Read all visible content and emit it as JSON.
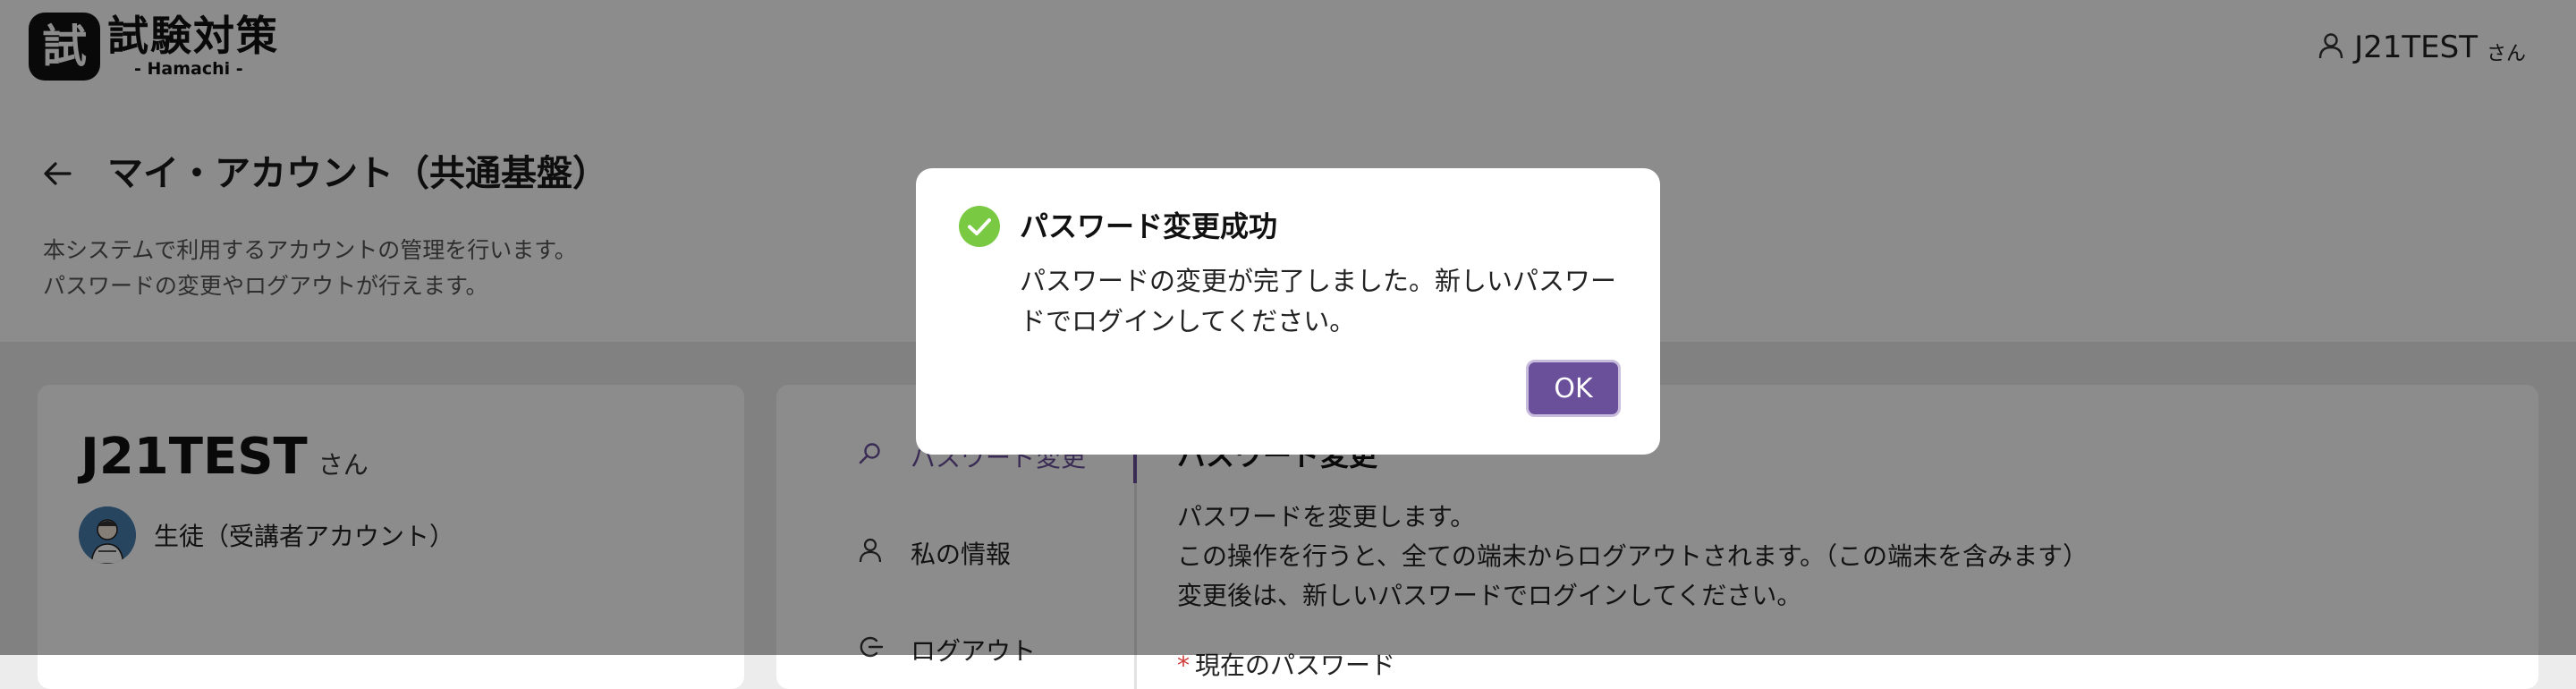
{
  "header": {
    "logo_mark": "試",
    "logo_title": "試験対策",
    "logo_subtitle": "- Hamachi -",
    "user_name": "J21TEST",
    "user_suffix": "さん"
  },
  "page": {
    "title": "マイ・アカウント（共通基盤）",
    "description_line1": "本システムで利用するアカウントの管理を行います。",
    "description_line2": "パスワードの変更やログアウトが行えます。"
  },
  "account": {
    "name": "J21TEST",
    "suffix": "さん",
    "role": "生徒（受講者アカウント）"
  },
  "menu": {
    "items": [
      {
        "label": "パスワード変更",
        "icon": "search-icon",
        "active": true
      },
      {
        "label": "私の情報",
        "icon": "person-icon",
        "active": false
      },
      {
        "label": "ログアウト",
        "icon": "logout-icon",
        "active": false
      }
    ]
  },
  "content": {
    "title": "パスワード変更",
    "desc_line1": "パスワードを変更します。",
    "desc_line2": "この操作を行うと、全ての端末からログアウトされます。（この端末を含みます）",
    "desc_line3": "変更後は、新しいパスワードでログインしてください。",
    "field_required_mark": "*",
    "field_label": "現在のパスワード"
  },
  "dialog": {
    "title": "パスワード変更成功",
    "message_line1": "パスワードの変更が完了しました。新しいパスワー",
    "message_line2": "ドでログインしてください。",
    "ok_label": "OK",
    "icon": "check-circle-icon",
    "icon_color": "#7ac943",
    "button_color": "#6a4f9a"
  }
}
